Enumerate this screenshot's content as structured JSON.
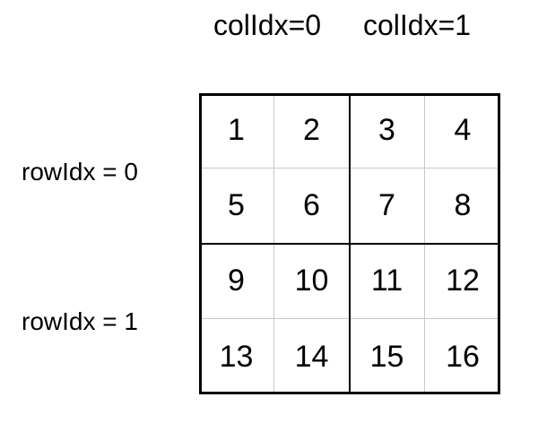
{
  "column_labels": [
    "colIdx=0",
    "colIdx=1"
  ],
  "row_labels": [
    "rowIdx = 0",
    "rowIdx = 1"
  ],
  "grid": {
    "rows": [
      [
        "1",
        "2",
        "3",
        "4"
      ],
      [
        "5",
        "6",
        "7",
        "8"
      ],
      [
        "9",
        "10",
        "11",
        "12"
      ],
      [
        "13",
        "14",
        "15",
        "16"
      ]
    ]
  }
}
